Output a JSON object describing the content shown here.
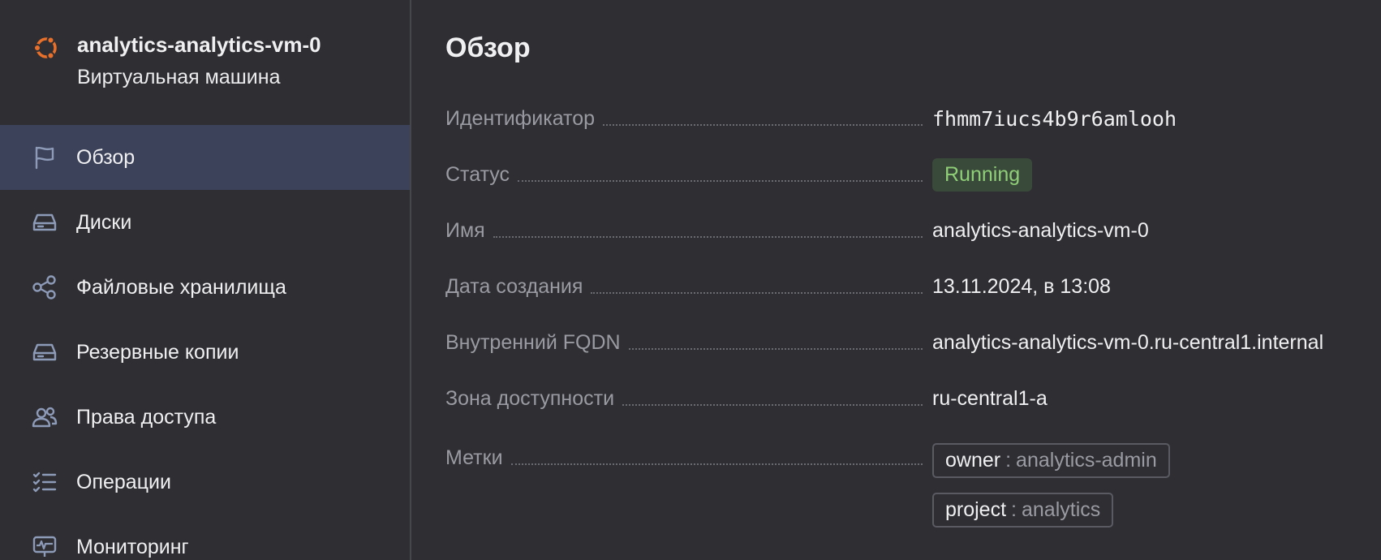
{
  "vm": {
    "name": "analytics-analytics-vm-0",
    "type": "Виртуальная машина",
    "logo_icon": "ubuntu-icon",
    "logo_color": "#e8702a"
  },
  "nav": {
    "items": [
      {
        "label": "Обзор",
        "icon": "flag-icon",
        "active": true
      },
      {
        "label": "Диски",
        "icon": "disk-icon"
      },
      {
        "label": "Файловые хранилища",
        "icon": "share-nodes-icon"
      },
      {
        "label": "Резервные копии",
        "icon": "backup-disk-icon"
      },
      {
        "label": "Права доступа",
        "icon": "users-icon"
      },
      {
        "label": "Операции",
        "icon": "checklist-icon"
      },
      {
        "label": "Мониторинг",
        "icon": "monitor-icon"
      }
    ]
  },
  "overview": {
    "title": "Обзор",
    "id": {
      "label": "Идентификатор",
      "value": "fhmm7iucs4b9r6amlooh"
    },
    "status": {
      "label": "Статус",
      "value": "Running",
      "color": "#8fcf78"
    },
    "name": {
      "label": "Имя",
      "value": "analytics-analytics-vm-0"
    },
    "created": {
      "label": "Дата создания",
      "value": "13.11.2024, в 13:08"
    },
    "fqdn": {
      "label": "Внутренний FQDN",
      "value": "analytics-analytics-vm-0.ru-central1.internal"
    },
    "zone": {
      "label": "Зона доступности",
      "value": "ru-central1-a"
    },
    "labels": {
      "label": "Метки",
      "items": [
        {
          "key": "owner",
          "sep": ":",
          "value": "analytics-admin"
        },
        {
          "key": "project",
          "sep": ":",
          "value": "analytics"
        }
      ]
    }
  }
}
